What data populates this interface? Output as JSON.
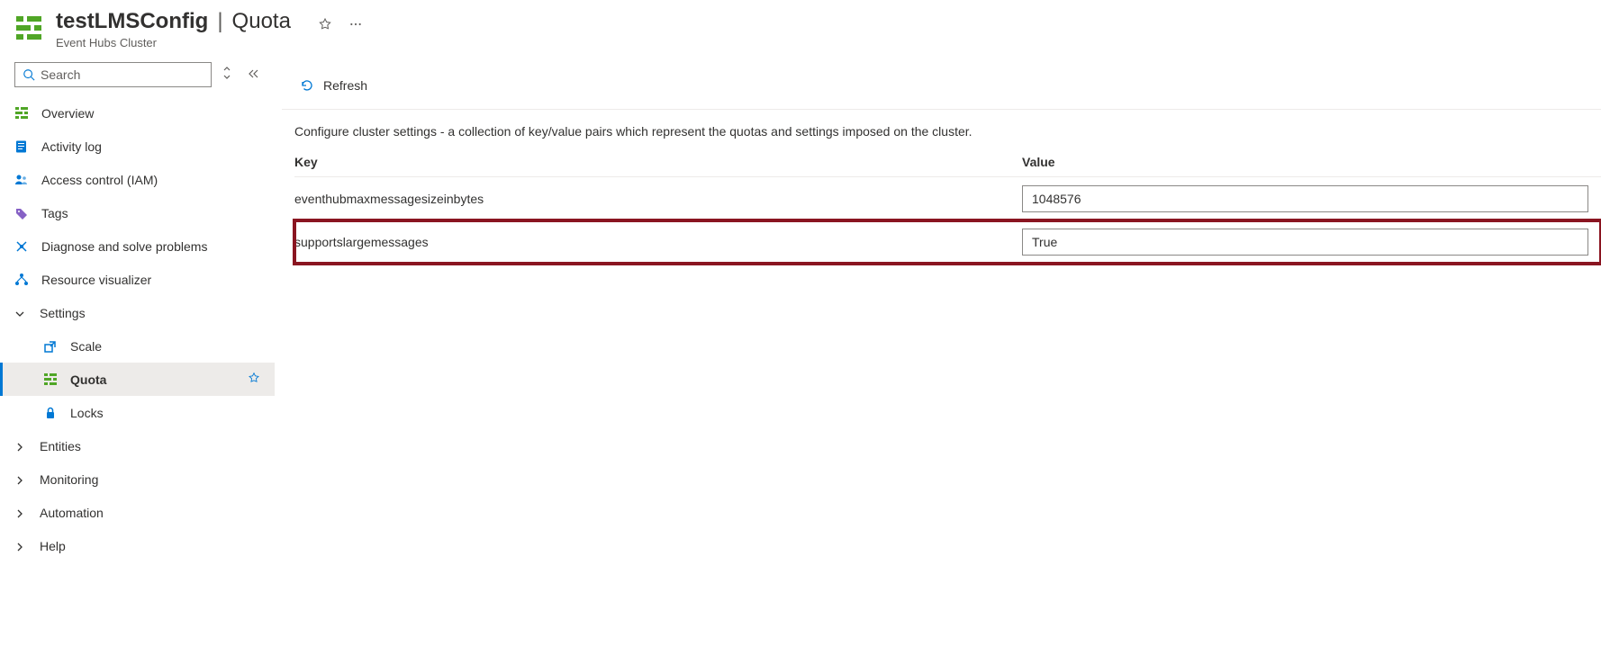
{
  "header": {
    "resource_name": "testLMSConfig",
    "section": "Quota",
    "subtitle": "Event Hubs Cluster"
  },
  "sidebar": {
    "search_placeholder": "Search",
    "items": [
      {
        "label": "Overview"
      },
      {
        "label": "Activity log"
      },
      {
        "label": "Access control (IAM)"
      },
      {
        "label": "Tags"
      },
      {
        "label": "Diagnose and solve problems"
      },
      {
        "label": "Resource visualizer"
      }
    ],
    "settings_group": {
      "label": "Settings",
      "children": [
        {
          "label": "Scale"
        },
        {
          "label": "Quota"
        },
        {
          "label": "Locks"
        }
      ]
    },
    "other_groups": [
      {
        "label": "Entities"
      },
      {
        "label": "Monitoring"
      },
      {
        "label": "Automation"
      },
      {
        "label": "Help"
      }
    ]
  },
  "main": {
    "refresh_label": "Refresh",
    "description": "Configure cluster settings - a collection of key/value pairs which represent the quotas and settings imposed on the cluster.",
    "columns": {
      "key": "Key",
      "value": "Value"
    },
    "rows": [
      {
        "key": "eventhubmaxmessagesizeinbytes",
        "value": "1048576",
        "highlighted": false
      },
      {
        "key": "supportslargemessages",
        "value": "True",
        "highlighted": true
      }
    ]
  }
}
